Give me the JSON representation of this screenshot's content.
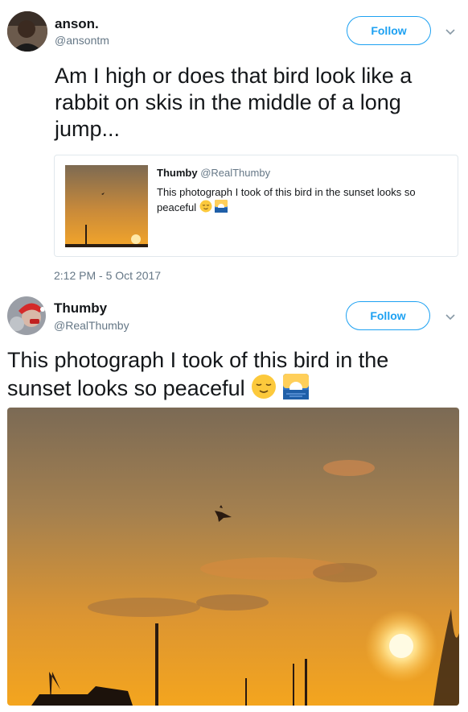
{
  "tweet1": {
    "name": "anson.",
    "handle": "@ansontm",
    "follow_label": "Follow",
    "text": "Am I high or does that bird look like a rabbit on skis in the middle of a long jump...",
    "quoted": {
      "name": "Thumby",
      "handle": "@RealThumby",
      "text": "This photograph I took of this bird in the sunset looks so peaceful"
    },
    "timestamp": "2:12 PM - 5 Oct 2017"
  },
  "tweet2": {
    "name": "Thumby",
    "handle": "@RealThumby",
    "follow_label": "Follow",
    "text": "This photograph I took of this bird in the sunset looks so peaceful"
  },
  "icons": {
    "relieved_face": "relieved-face-emoji",
    "sunrise": "sunrise-emoji",
    "chevron": "chevron-down-icon"
  },
  "colors": {
    "accent": "#1da1f2",
    "muted": "#657786",
    "sunset_top": "#8a6f4f",
    "sunset_bottom": "#f6a21e"
  }
}
